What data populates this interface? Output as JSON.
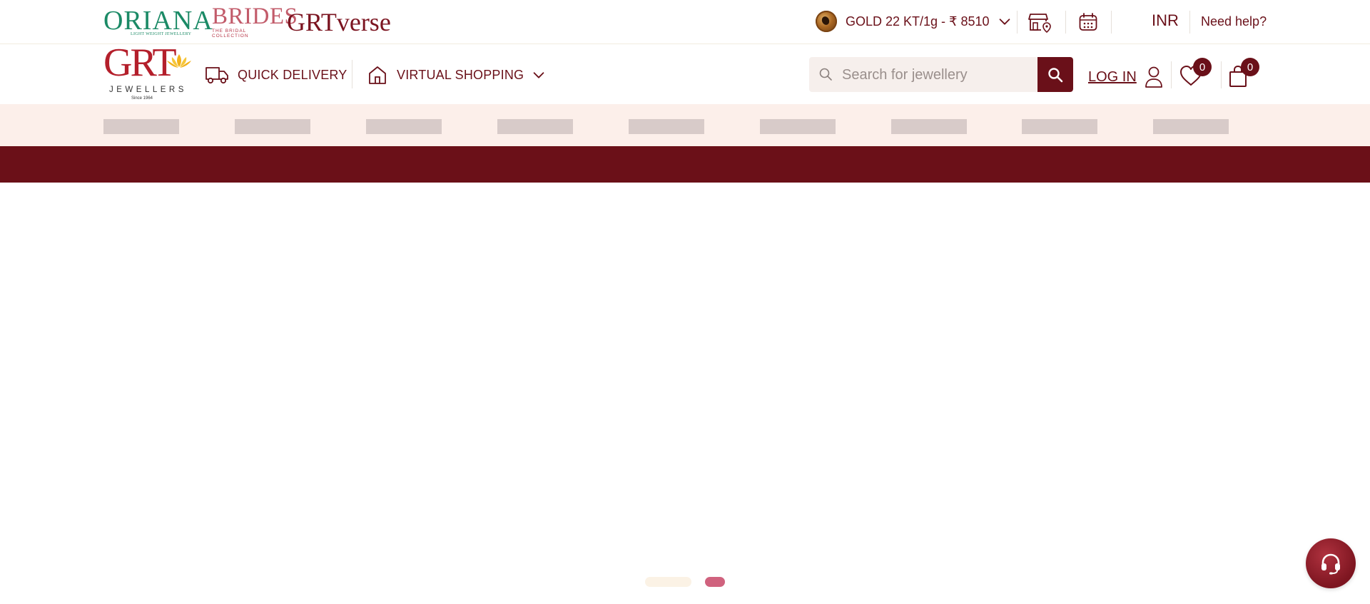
{
  "brands": {
    "oriana": {
      "name": "ORIANA",
      "tagline": "LIGHT WEIGHT JEWELLERY"
    },
    "brides": {
      "name": "BRIDES",
      "tagline": "THE BRIDAL COLLECTION"
    },
    "grtverse": {
      "name": "GRTverse"
    }
  },
  "topbar": {
    "gold_rate": "GOLD 22 KT/1g - ₹ 8510",
    "currency": "INR",
    "help": "Need help?"
  },
  "logo": {
    "name": "GRT",
    "subtitle": "JEWELLERS",
    "since": "Since 1964"
  },
  "nav": {
    "quick_delivery": "QUICK DELIVERY",
    "virtual_shopping": "VIRTUAL SHOPPING"
  },
  "search": {
    "placeholder": "Search for jewellery"
  },
  "account": {
    "login_label": "LOG IN",
    "wishlist_count": "0",
    "cart_count": "0"
  },
  "category_placeholders": 9,
  "carousel": {
    "slides": 2,
    "active_index": 1
  },
  "colors": {
    "maroon": "#6a1019",
    "band_bg": "#fcefea",
    "skeleton": "#d8cbc9",
    "active_dot": "#d0627e"
  },
  "icons": {
    "gold_coin": "gold-coin-icon",
    "store_locator": "store-location-icon",
    "calendar": "calendar-icon",
    "delivery": "delivery-truck-icon",
    "home": "home-icon",
    "search": "search-icon",
    "user": "user-icon",
    "wishlist": "heart-icon",
    "cart": "shopping-bag-icon",
    "support": "headset-icon"
  }
}
